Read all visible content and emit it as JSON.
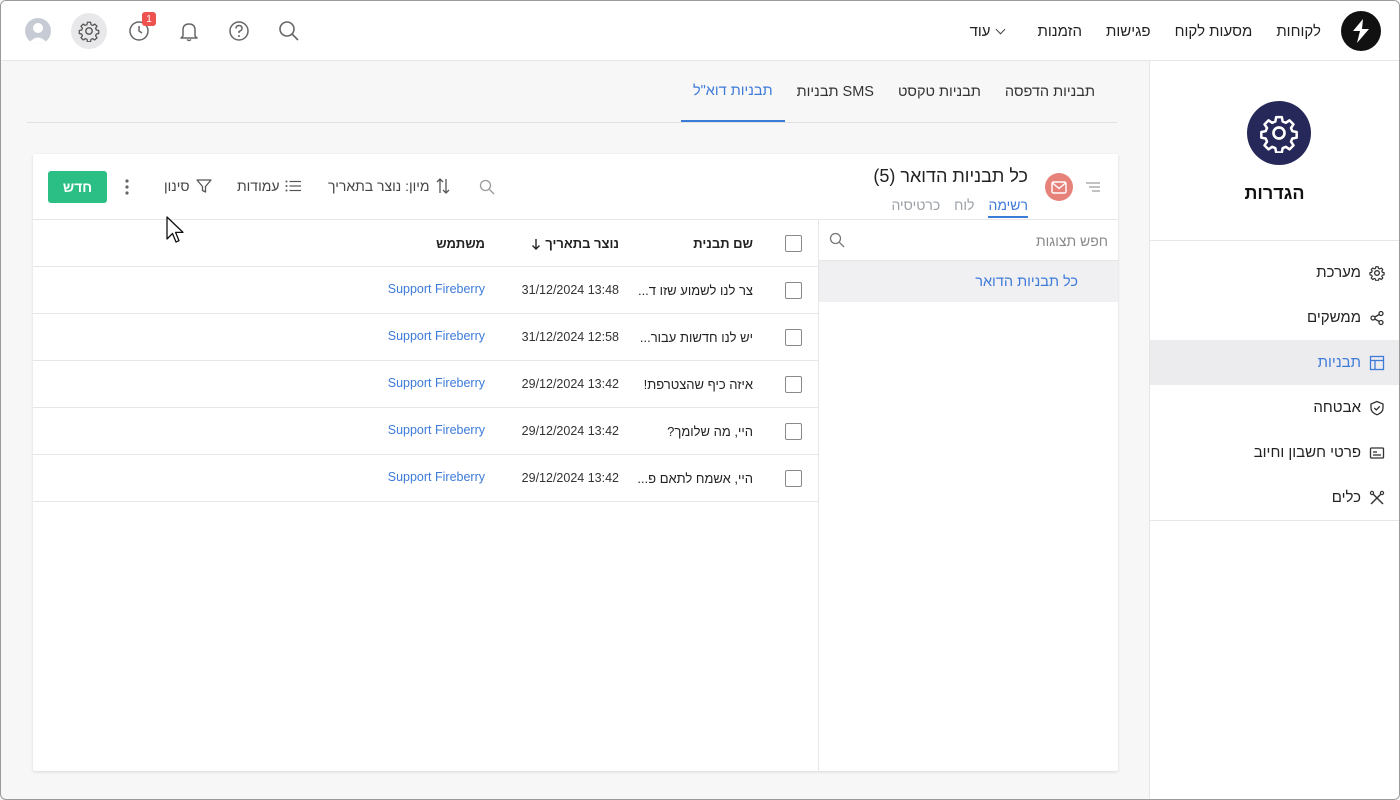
{
  "topbar": {
    "nav": [
      "לקוחות",
      "מסעות לקוח",
      "פגישות",
      "הזמנות",
      "עוד"
    ],
    "notifications_badge": "1"
  },
  "sidebar": {
    "title": "הגדרות",
    "items": [
      {
        "label": "מערכת",
        "icon": "gear-icon"
      },
      {
        "label": "ממשקים",
        "icon": "share-icon"
      },
      {
        "label": "תבניות",
        "icon": "template-icon",
        "active": true
      },
      {
        "label": "אבטחה",
        "icon": "shield-icon"
      },
      {
        "label": "פרטי חשבון וחיוב",
        "icon": "card-icon"
      },
      {
        "label": "כלים",
        "icon": "tools-icon"
      }
    ]
  },
  "tabs": [
    "תבניות הדפסה",
    "תבניות טקסט",
    "תבניות SMS",
    "תבניות דוא\"ל"
  ],
  "card": {
    "title": "כל תבניות הדואר (5)",
    "view_tabs": [
      "רשימה",
      "לוח",
      "כרטיסיה"
    ],
    "sort_label": "מיון: נוצר בתאריך",
    "columns_label": "עמודות",
    "filter_label": "סינון",
    "new_label": "חדש"
  },
  "views": {
    "search_placeholder": "חפש תצוגות",
    "items": [
      "כל תבניות הדואר"
    ]
  },
  "table": {
    "headers": {
      "name": "שם תבנית",
      "created": "נוצר בתאריך",
      "user": "משתמש"
    },
    "rows": [
      {
        "name": "צר לנו לשמוע שזו ד...",
        "created": "31/12/2024 13:48",
        "user": "Support Fireberry"
      },
      {
        "name": "יש לנו חדשות עבור...",
        "created": "31/12/2024 12:58",
        "user": "Support Fireberry"
      },
      {
        "name": "איזה כיף שהצטרפת!",
        "created": "29/12/2024 13:42",
        "user": "Support Fireberry"
      },
      {
        "name": "היי, מה שלומך?",
        "created": "29/12/2024 13:42",
        "user": "Support Fireberry"
      },
      {
        "name": "היי, אשמח לתאם פ...",
        "created": "29/12/2024 13:42",
        "user": "Support Fireberry"
      }
    ]
  },
  "colors": {
    "accent": "#3d7bd9",
    "new_button": "#2bbf85",
    "settings_circle": "#26285a",
    "mail_circle": "#e6827a"
  }
}
